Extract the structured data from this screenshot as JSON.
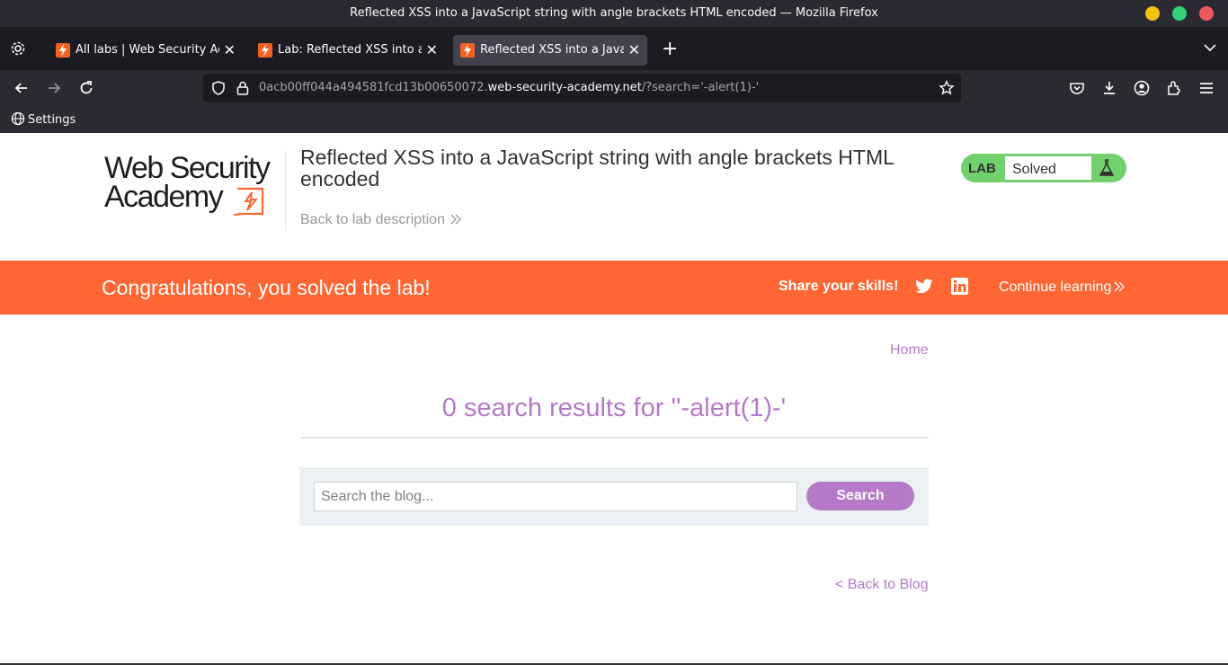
{
  "window": {
    "title": "Reflected XSS into a JavaScript string with angle brackets HTML encoded — Mozilla Firefox"
  },
  "tabs": [
    {
      "label": "All labs | Web Security Academy",
      "active": false
    },
    {
      "label": "Lab: Reflected XSS into a JavaScript string",
      "active": false
    },
    {
      "label": "Reflected XSS into a JavaScript string",
      "active": true
    }
  ],
  "urlbar": {
    "prefix": "0acb00ff044a494581fcd13b00650072.",
    "host": "web-security-academy.net",
    "path": "/?search='-alert(1)-'"
  },
  "bookmarks": {
    "settings_label": "Settings"
  },
  "header": {
    "logo_line1": "Web Security",
    "logo_line2": "Academy",
    "lab_title": "Reflected XSS into a JavaScript string with angle brackets HTML encoded",
    "back_to_description": "Back to lab description",
    "lab_tag": "LAB",
    "status": "Solved"
  },
  "banner": {
    "congrats": "Congratulations, you solved the lab!",
    "share": "Share your skills!",
    "continue": "Continue learning"
  },
  "blog": {
    "home_link": "Home",
    "results_heading": "0 search results for ''-alert(1)-'",
    "search_placeholder": "Search the blog...",
    "search_button": "Search",
    "back_link": "< Back to Blog"
  },
  "colors": {
    "accent": "#b679c8",
    "banner": "#ff6633",
    "solved": "#70d16d"
  }
}
